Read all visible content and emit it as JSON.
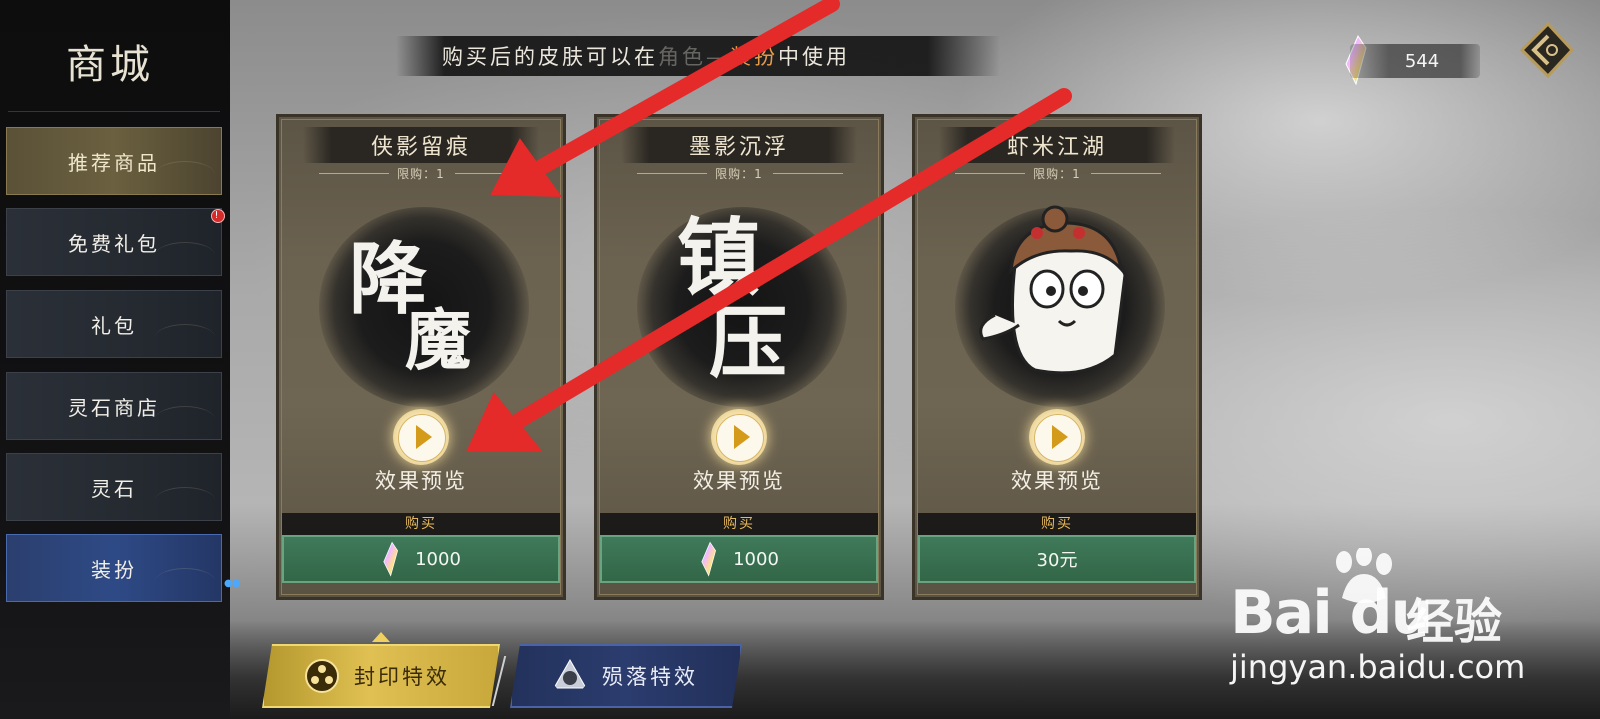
{
  "sidebar": {
    "title": "商城",
    "items": [
      {
        "label": "推荐商品"
      },
      {
        "label": "免费礼包",
        "badge": "!"
      },
      {
        "label": "礼包"
      },
      {
        "label": "灵石商店"
      },
      {
        "label": "灵石"
      },
      {
        "label": "装扮"
      }
    ]
  },
  "notice": {
    "prefix": "购买后的皮肤可以在",
    "hidden": "角色—",
    "highlight": "装扮",
    "suffix": "中使用"
  },
  "currency": {
    "amount": "544",
    "icon": "spirit-crystal-icon"
  },
  "cards": [
    {
      "title": "侠影留痕",
      "limit": "限购：1",
      "art_text": [
        "降",
        "魔"
      ],
      "preview_label": "效果预览",
      "buy_label": "购买",
      "price": "1000",
      "price_icon": "spirit-crystal-icon"
    },
    {
      "title": "墨影沉浮",
      "limit": "限购：1",
      "art_text": [
        "镇",
        "压"
      ],
      "preview_label": "效果预览",
      "buy_label": "购买",
      "price": "1000",
      "price_icon": "spirit-crystal-icon"
    },
    {
      "title": "虾米江湖",
      "limit": "限购：1",
      "art_text": [],
      "preview_label": "效果预览",
      "buy_label": "购买",
      "price": "30元",
      "price_icon": ""
    }
  ],
  "tabs": [
    {
      "label": "封印特效",
      "icon": "seal-icon",
      "active": true
    },
    {
      "label": "殒落特效",
      "icon": "fall-icon",
      "active": false
    }
  ],
  "watermark": {
    "logo": "Bai du",
    "cn": "经验",
    "url": "jingyan.baidu.com"
  },
  "colors": {
    "accent_gold": "#e0c052",
    "price_green": "#3f7a5a",
    "highlight_orange": "#e89a4a",
    "annotation_red": "#e52a2a"
  }
}
